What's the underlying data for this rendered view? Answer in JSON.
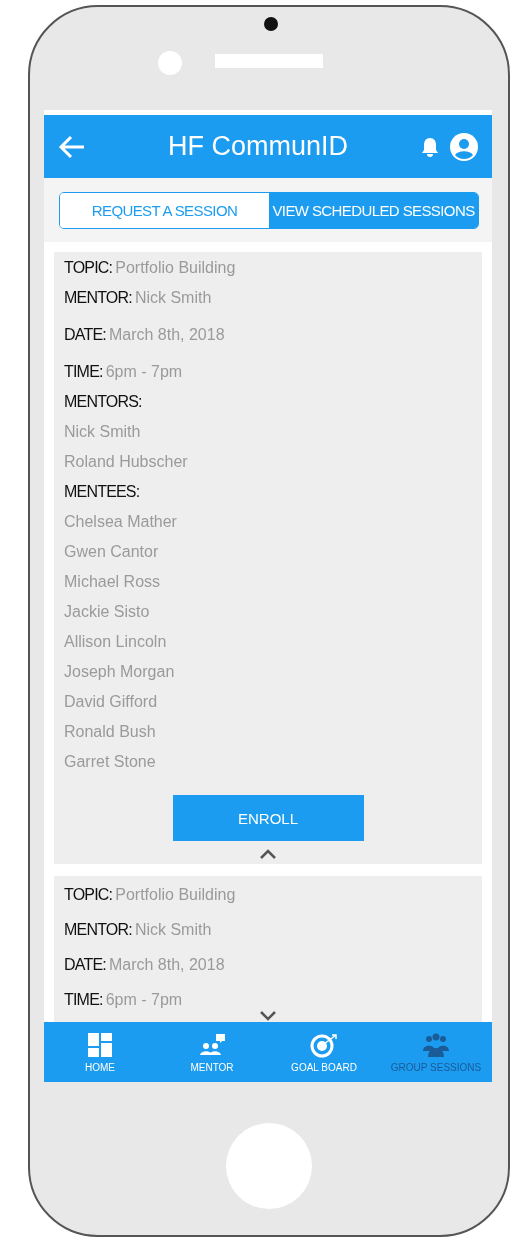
{
  "header": {
    "title": "HF CommunID"
  },
  "tabs": [
    {
      "label": "REQUEST A SESSION",
      "selected": false
    },
    {
      "label": "VIEW SCHEDULED SESSIONS",
      "selected": true
    }
  ],
  "sessions": [
    {
      "expanded": true,
      "fields": [
        {
          "label": "TOPIC:",
          "value": "Portfolio Building"
        },
        {
          "label": "MENTOR:",
          "value": "Nick Smith"
        },
        {
          "label": "DATE:",
          "value": "March 8th, 2018"
        },
        {
          "label": "TIME:",
          "value": "6pm - 7pm"
        }
      ],
      "mentors_heading": "MENTORS:",
      "mentors": [
        "Nick Smith",
        "Roland Hubscher"
      ],
      "mentees_heading": "MENTEES:",
      "mentees": [
        "Chelsea Mather",
        "Gwen Cantor",
        "Michael Ross",
        "Jackie Sisto",
        "Allison Lincoln",
        "Joseph Morgan",
        "David Gifford",
        "Ronald Bush",
        "Garret Stone"
      ],
      "button": "ENROLL"
    },
    {
      "expanded": false,
      "fields": [
        {
          "label": "TOPIC:",
          "value": "Portfolio Building"
        },
        {
          "label": "MENTOR:",
          "value": "Nick Smith"
        },
        {
          "label": "DATE:",
          "value": "March 8th, 2018"
        },
        {
          "label": "TIME:",
          "value": "6pm - 7pm"
        }
      ]
    }
  ],
  "nav": [
    {
      "kind": "home",
      "label": "HOME",
      "selected": false
    },
    {
      "kind": "mentor",
      "label": "MENTOR",
      "selected": false
    },
    {
      "kind": "goal",
      "label": "GOAL BOARD",
      "selected": false
    },
    {
      "kind": "group",
      "label": "GROUP SESSIONS",
      "selected": true
    }
  ]
}
